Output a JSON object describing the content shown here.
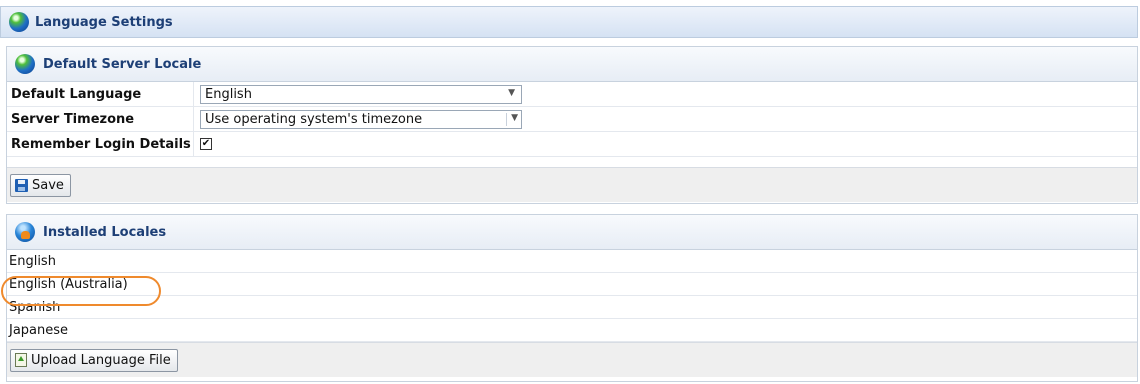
{
  "page": {
    "title": "Language Settings"
  },
  "server_locale": {
    "title": "Default Server Locale",
    "fields": [
      {
        "label": "Default Language",
        "value": "English"
      },
      {
        "label": "Server Timezone",
        "value": "Use operating system's timezone"
      },
      {
        "label": "Remember Login Details",
        "checked": true,
        "check_glyph": "☑"
      }
    ],
    "save_label": "Save"
  },
  "installed_locales": {
    "title": "Installed Locales",
    "items": [
      "English",
      "English (Australia)",
      "Spanish",
      "Japanese"
    ],
    "upload_label": "Upload Language File"
  },
  "icons": {
    "page": "globe-icon",
    "server_locale": "globe-icon",
    "installed_locales": "user-icon",
    "save": "floppy-disk-icon",
    "upload": "upload-file-icon",
    "dropdown": "chevron-down-icon"
  },
  "colors": {
    "header_text": "#1d3f76",
    "highlight": "#ef8a2d"
  }
}
